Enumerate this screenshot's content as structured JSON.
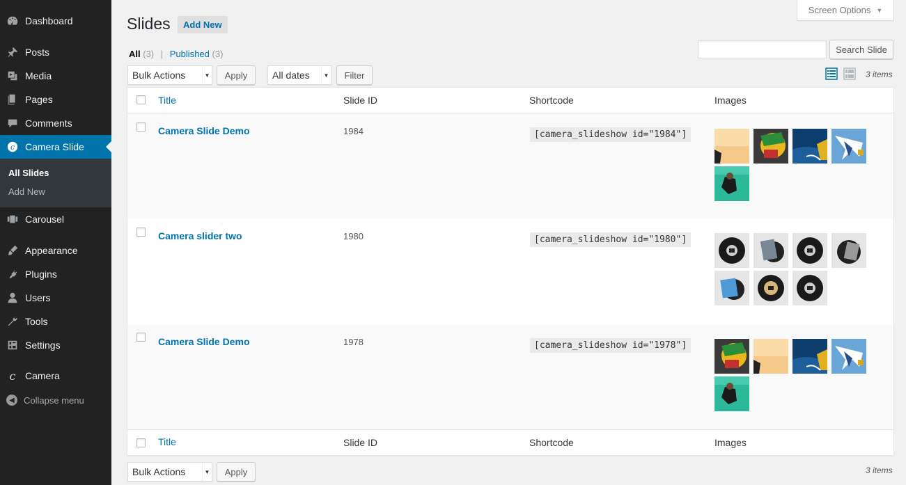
{
  "sidebar": {
    "items": [
      {
        "label": "Dashboard",
        "icon": "dashboard-icon"
      },
      {
        "label": "Posts",
        "icon": "pushpin-icon"
      },
      {
        "label": "Media",
        "icon": "media-icon"
      },
      {
        "label": "Pages",
        "icon": "pages-icon"
      },
      {
        "label": "Comments",
        "icon": "comment-icon"
      },
      {
        "label": "Camera Slide",
        "icon": "camera-c-icon"
      },
      {
        "label": "Carousel",
        "icon": "carousel-icon"
      },
      {
        "label": "Appearance",
        "icon": "paintbrush-icon"
      },
      {
        "label": "Plugins",
        "icon": "plug-icon"
      },
      {
        "label": "Users",
        "icon": "user-icon"
      },
      {
        "label": "Tools",
        "icon": "wrench-icon"
      },
      {
        "label": "Settings",
        "icon": "settings-icon"
      },
      {
        "label": "Camera",
        "icon": "camera-c-icon"
      }
    ],
    "submenu": [
      "All Slides",
      "Add New"
    ],
    "collapse_label": "Collapse menu"
  },
  "header": {
    "title": "Slides",
    "add_new": "Add New",
    "screen_options": "Screen Options"
  },
  "filters": {
    "all_label": "All",
    "all_count": "(3)",
    "separator": "|",
    "published_label": "Published",
    "published_count": "(3)"
  },
  "search": {
    "button": "Search Slide",
    "value": ""
  },
  "toolbar": {
    "bulk_actions": "Bulk Actions",
    "apply": "Apply",
    "all_dates": "All dates",
    "filter": "Filter",
    "items_count": "3 items"
  },
  "table": {
    "columns": [
      "Title",
      "Slide ID",
      "Shortcode",
      "Images"
    ],
    "rows": [
      {
        "title": "Camera Slide Demo",
        "slide_id": "1984",
        "shortcode": "[camera_slideshow id=\"1984\"]"
      },
      {
        "title": "Camera slider two",
        "slide_id": "1980",
        "shortcode": "[camera_slideshow id=\"1980\"]"
      },
      {
        "title": "Camera Slide Demo",
        "slide_id": "1978",
        "shortcode": "[camera_slideshow id=\"1978\"]"
      }
    ]
  },
  "colors": {
    "sidebar_bg": "#222222",
    "active_menu": "#0073aa",
    "link": "#0073aa"
  }
}
